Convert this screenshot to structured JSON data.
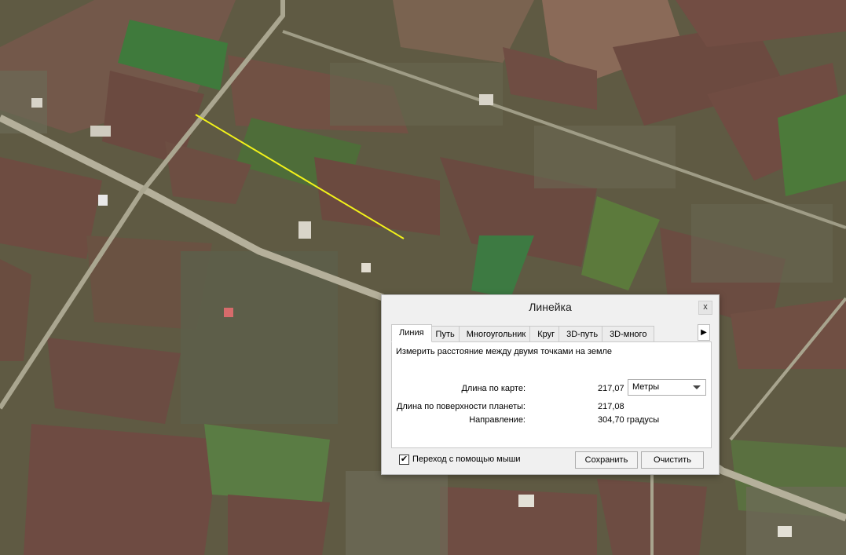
{
  "dialog": {
    "title": "Линейка",
    "close_glyph": "x",
    "tabs": [
      "Линия",
      "Путь",
      "Многоугольник",
      "Круг",
      "3D-путь",
      "3D-много"
    ],
    "tab_arrow_glyph": "▶",
    "description": "Измерить расстояние между двумя точками на земле",
    "map_length_label": "Длина по карте:",
    "map_length_value": "217,07",
    "units_selected": "Метры",
    "surface_length_label": "Длина по поверхности планеты:",
    "surface_length_value": "217,08",
    "heading_label": "Направление:",
    "heading_value": "304,70 градусы",
    "mouse_nav_label": "Переход с помощью мыши",
    "mouse_nav_checked": true,
    "check_glyph": "✔",
    "save_label": "Сохранить",
    "clear_label": "Очистить"
  },
  "colors": {
    "measure_line": "#f2f21a",
    "field_brown": "#6e4a3c",
    "field_green": "#4f7a3f",
    "road": "#b8b39e"
  }
}
